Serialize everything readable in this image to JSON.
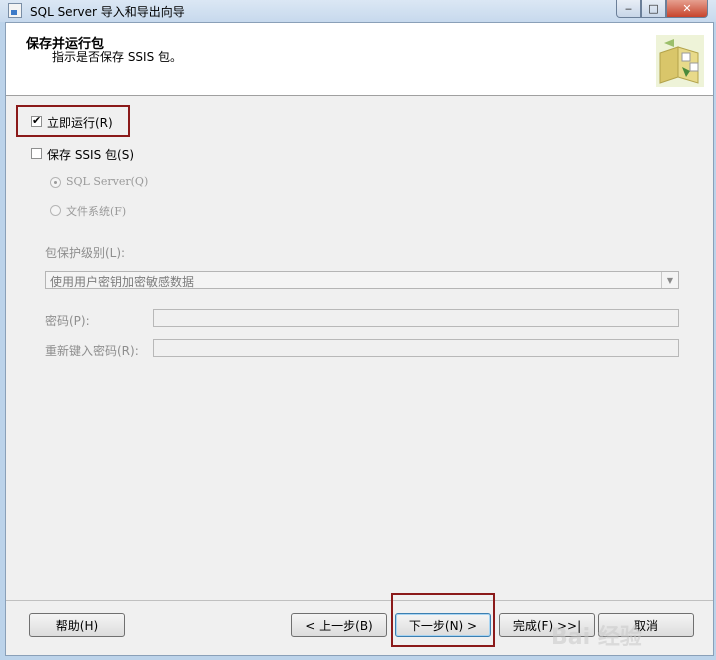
{
  "window": {
    "title": "SQL Server 导入和导出向导",
    "controls": {
      "minimize": "‒",
      "maximize": "□",
      "close": "✕"
    }
  },
  "header": {
    "title": "保存并运行包",
    "subtitle": "指示是否保存 SSIS 包。"
  },
  "options": {
    "run_now": {
      "label": "立即运行(R)",
      "checked": true
    },
    "save_ssis": {
      "label": "保存 SSIS 包(S)",
      "checked": false
    },
    "destinations": [
      {
        "label": "SQL Server(Q)",
        "selected": true
      },
      {
        "label": "文件系统(F)",
        "selected": false
      }
    ]
  },
  "protection": {
    "label": "包保护级别(L):",
    "value": "使用用户密钥加密敏感数据"
  },
  "password": {
    "label": "密码(P):",
    "value": ""
  },
  "retype_password": {
    "label": "重新键入密码(R):",
    "value": ""
  },
  "buttons": {
    "help": "帮助(H)",
    "back": "< 上一步(B)",
    "next": "下一步(N) >",
    "finish": "完成(F) >>|",
    "cancel": "取消"
  },
  "watermark": "Bai 经验",
  "colors": {
    "highlight": "#8b1a1a",
    "accent": "#3c7fb1"
  },
  "icons": [
    "wizard-package-icon",
    "app-icon",
    "chevron-down-icon"
  ]
}
